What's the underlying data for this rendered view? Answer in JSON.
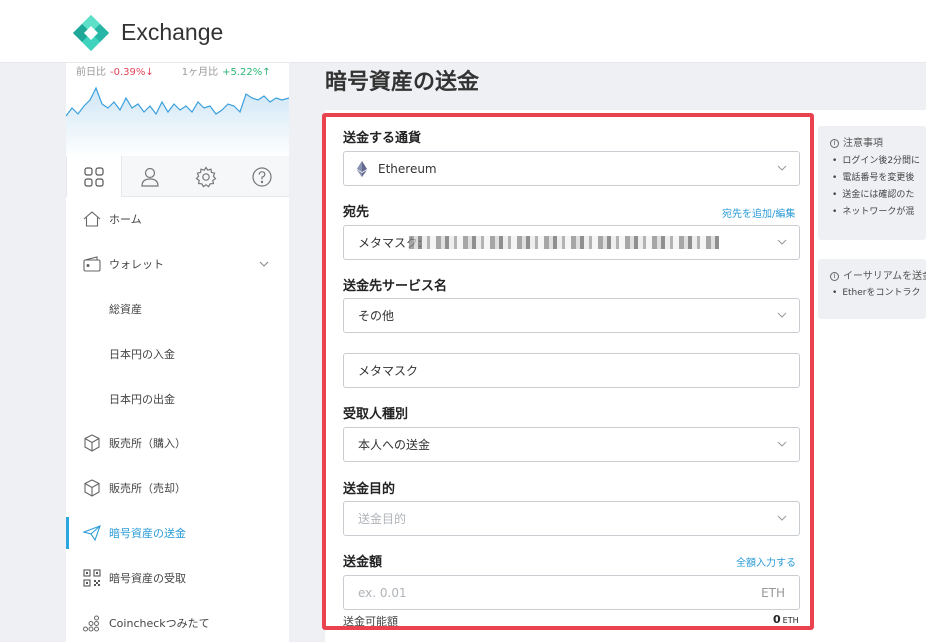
{
  "header": {
    "brand": "Exchange"
  },
  "ticker": {
    "day_label": "前日比",
    "day_change": "-0.39%↓",
    "month_label": "1ヶ月比",
    "month_change": "+5.22%↑"
  },
  "sidebar": {
    "tabs": [
      {
        "name": "tab-dashboard",
        "icon": "grid-icon"
      },
      {
        "name": "tab-account",
        "icon": "user-icon"
      },
      {
        "name": "tab-settings",
        "icon": "gear-icon"
      },
      {
        "name": "tab-help",
        "icon": "help-icon"
      }
    ],
    "items": [
      {
        "label": "ホーム",
        "icon": "home-icon"
      },
      {
        "label": "ウォレット",
        "icon": "wallet-icon"
      },
      {
        "label": "総資産"
      },
      {
        "label": "日本円の入金"
      },
      {
        "label": "日本円の出金"
      },
      {
        "label": "販売所（購入）",
        "icon": "box-icon"
      },
      {
        "label": "販売所（売却）",
        "icon": "box-icon"
      },
      {
        "label": "暗号資産の送金",
        "icon": "send-icon",
        "active": true
      },
      {
        "label": "暗号資産の受取",
        "icon": "qr-icon"
      },
      {
        "label": "Coincheckつみたて",
        "icon": "coins-icon"
      }
    ]
  },
  "page": {
    "title": "暗号資産の送金"
  },
  "form": {
    "currency_label": "送金する通貨",
    "currency_value": "Ethereum",
    "dest_label": "宛先",
    "dest_link": "宛先を追加/編集",
    "dest_value": "メタマスク:",
    "service_label": "送金先サービス名",
    "service_value": "その他",
    "service_other_value": "メタマスク",
    "recipient_label": "受取人種別",
    "recipient_value": "本人への送金",
    "purpose_label": "送金目的",
    "purpose_placeholder": "送金目的",
    "amount_label": "送金額",
    "amount_link": "全額入力する",
    "amount_placeholder": "ex. 0.01",
    "amount_unit": "ETH",
    "available_label": "送金可能額",
    "available_value": "0",
    "available_unit": "ETH"
  },
  "info": {
    "notice_title": "注意事項",
    "notice_items": [
      "ログイン後2分間に",
      "電話番号を変更後",
      "送金には確認のた",
      "ネットワークが混"
    ],
    "eth_title": "イーサリアムを送金",
    "eth_items": [
      "Etherをコントラク"
    ]
  },
  "colors": {
    "accent": "#2a9bd6",
    "highlight": "#e8434f",
    "neg": "#e4445a",
    "pos": "#2bb673"
  }
}
